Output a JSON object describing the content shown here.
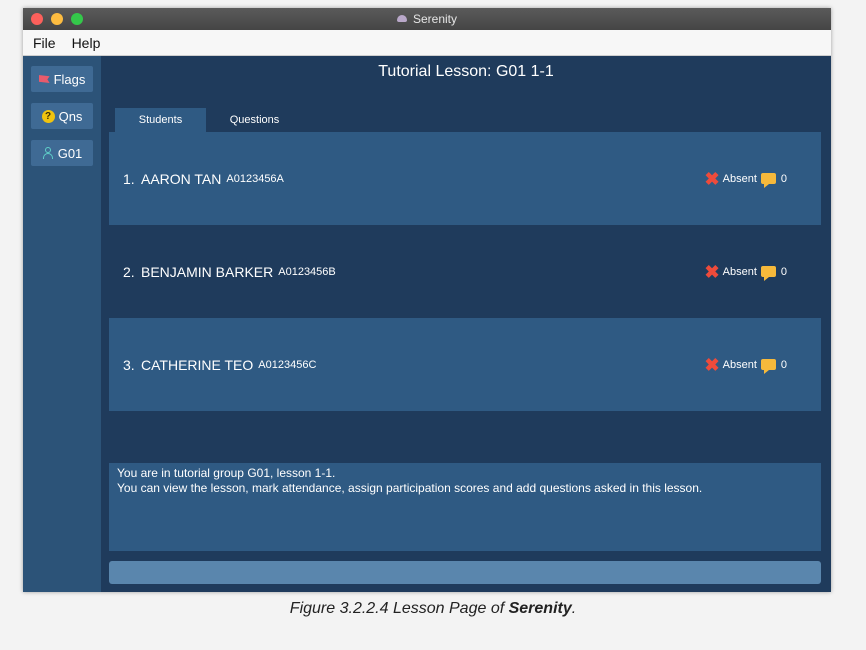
{
  "window": {
    "title": "Serenity"
  },
  "menu": {
    "file": "File",
    "help": "Help"
  },
  "sidebar": {
    "flags": "Flags",
    "qns": "Qns",
    "g01": "G01"
  },
  "lesson": {
    "title": "Tutorial Lesson: G01 1-1"
  },
  "tabs": {
    "students": "Students",
    "questions": "Questions"
  },
  "students": [
    {
      "num": "1.",
      "name": "AARON TAN",
      "id": "A0123456A",
      "status": "Absent",
      "score": "0"
    },
    {
      "num": "2.",
      "name": "BENJAMIN BARKER",
      "id": "A0123456B",
      "status": "Absent",
      "score": "0"
    },
    {
      "num": "3.",
      "name": "CATHERINE TEO",
      "id": "A0123456C",
      "status": "Absent",
      "score": "0"
    }
  ],
  "info": {
    "line1": "You are in tutorial group G01, lesson 1-1.",
    "line2": "You can view the lesson, mark attendance, assign participation scores and add questions asked in this lesson."
  },
  "command_box": {
    "value": ""
  },
  "caption": {
    "prefix": "Figure 3.2.2.4 Lesson Page of ",
    "app": "Serenity",
    "suffix": "."
  },
  "icons": {
    "flags": "flag-icon",
    "qns": "question-icon",
    "g01": "person-icon",
    "absent": "cross-icon",
    "score": "comment-icon"
  },
  "colors": {
    "background": "#1f3b5c",
    "panel": "#2f5a83",
    "sidebar": "#2c5378",
    "absent": "#ee4b3b",
    "score": "#f6b93b"
  }
}
